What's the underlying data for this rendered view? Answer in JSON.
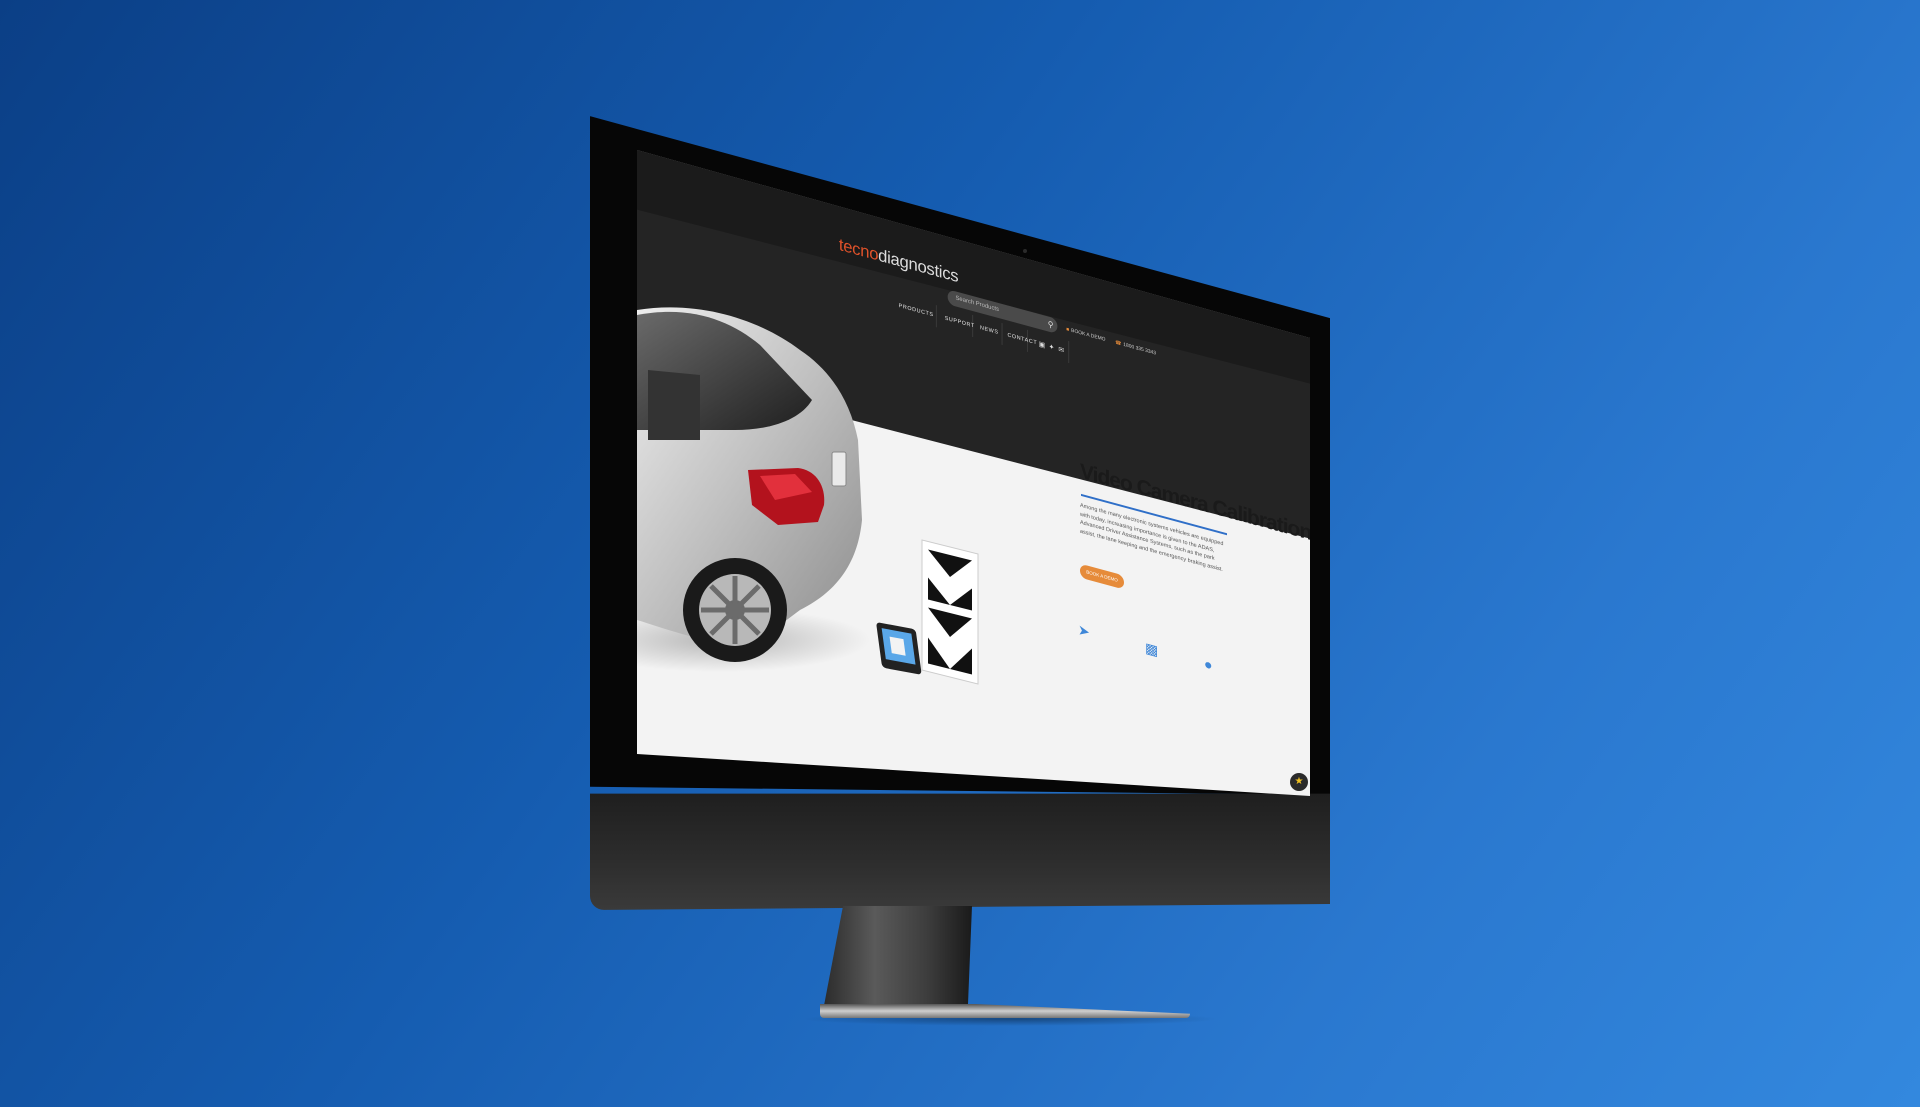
{
  "site": {
    "logo_prefix": "tecno",
    "logo_suffix": "diagnostics",
    "search_placeholder": "Search Products",
    "book_demo": "BOOK A DEMO",
    "phone": "1800 335 3343"
  },
  "nav": {
    "items": [
      {
        "label": "PRODUCTS"
      },
      {
        "label": "SUPPORT"
      },
      {
        "label": "NEWS"
      },
      {
        "label": "CONTACT"
      }
    ],
    "social": [
      "facebook-icon",
      "twitter-icon",
      "email-icon"
    ]
  },
  "hero": {
    "title": "Video Camera Calibration Kit",
    "description": "Among the many electronic systems vehicles are equipped with today, increasing importance is given to the ADAS, Advanced Driver Assistance Systems, such as the park assist, the lane keeping and the emergency braking assist.",
    "cta_label": "BOOK A DEMO",
    "features": [
      "rocket-icon",
      "box-icon",
      "chat-bubble-icon"
    ]
  },
  "colors": {
    "background_top": "#0b3f86",
    "background_bottom": "#3388de",
    "brand_accent": "#e0522a",
    "cta": "#e68b3a",
    "link_blue": "#2f6fc8"
  }
}
